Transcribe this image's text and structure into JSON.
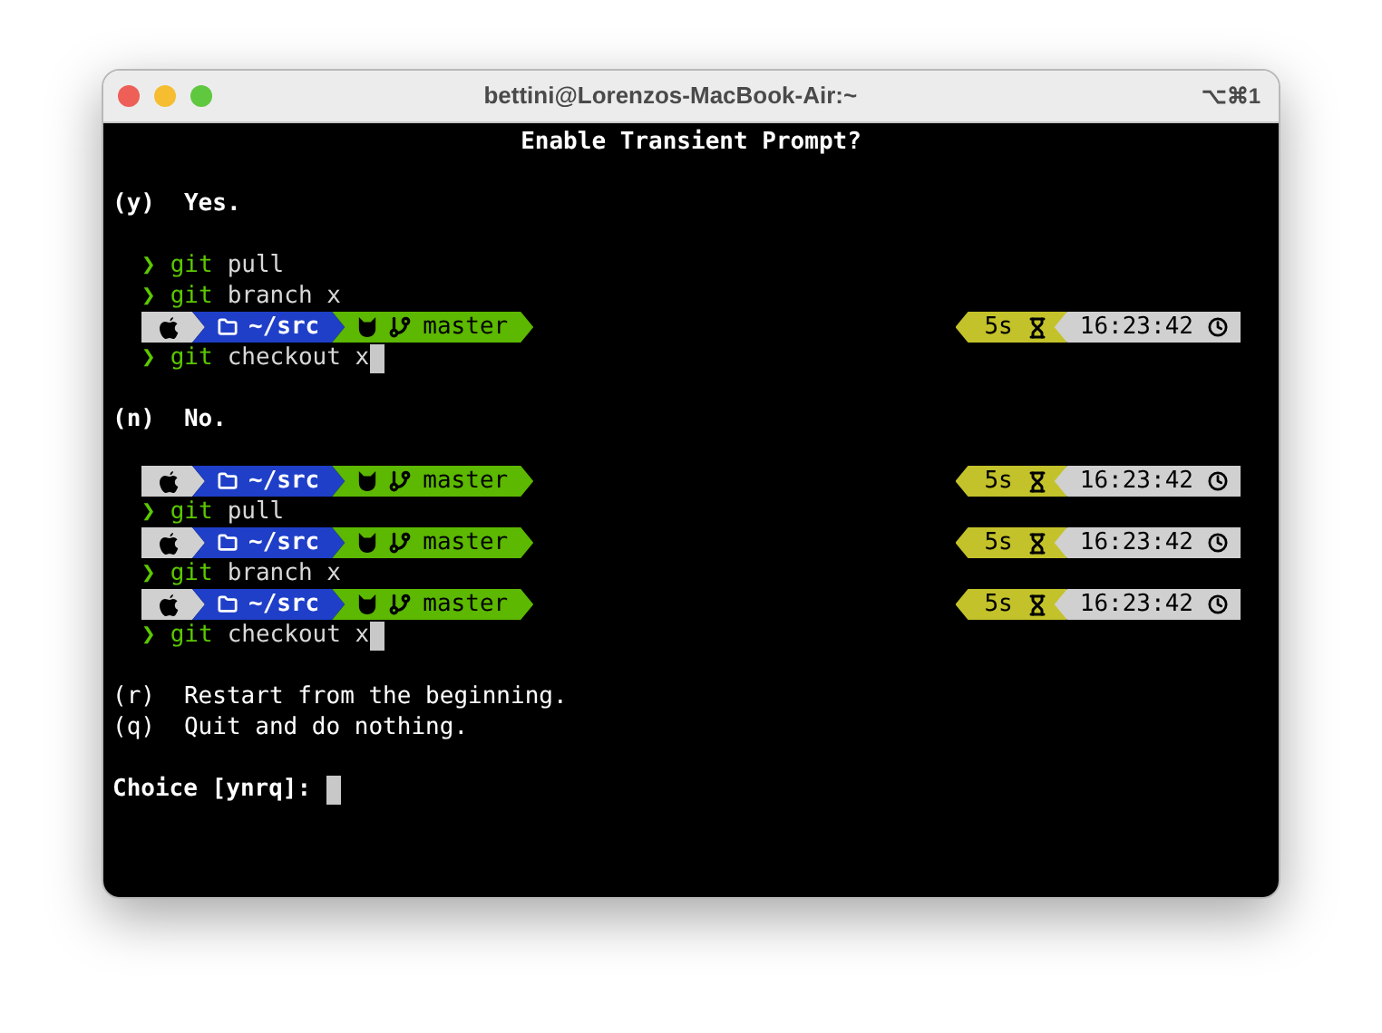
{
  "window": {
    "title": "bettini@Lorenzos-MacBook-Air:~",
    "shortcut": "⌥⌘1"
  },
  "lines": [
    {
      "kind": "heading",
      "text": "Enable Transient Prompt?"
    },
    {
      "kind": "blank"
    },
    {
      "kind": "option",
      "key": "(y)",
      "label": "Yes.",
      "bold": true
    },
    {
      "kind": "blank"
    },
    {
      "kind": "command",
      "prompt": "❯",
      "program": "git",
      "args": "pull",
      "cursor": false
    },
    {
      "kind": "command",
      "prompt": "❯",
      "program": "git",
      "args": "branch x",
      "cursor": false
    },
    {
      "kind": "prompt",
      "segments": [
        {
          "kind": "os",
          "color": "#d0d0d0"
        },
        {
          "kind": "dir",
          "text": "~/src",
          "color": "#1f3fc8"
        },
        {
          "kind": "git",
          "text": "master",
          "color": "#5cb800"
        }
      ],
      "right": [
        {
          "kind": "duration",
          "text": "5s",
          "color": "#c3c22a"
        },
        {
          "kind": "time",
          "text": "16:23:42",
          "color": "#d0d0d0"
        }
      ]
    },
    {
      "kind": "command",
      "prompt": "❯",
      "program": "git",
      "args": "checkout x",
      "cursor": true
    },
    {
      "kind": "blank"
    },
    {
      "kind": "option",
      "key": "(n)",
      "label": "No.",
      "bold": true
    },
    {
      "kind": "blank"
    },
    {
      "kind": "prompt",
      "segments": [
        {
          "kind": "os",
          "color": "#d0d0d0"
        },
        {
          "kind": "dir",
          "text": "~/src",
          "color": "#1f3fc8"
        },
        {
          "kind": "git",
          "text": "master",
          "color": "#5cb800"
        }
      ],
      "right": [
        {
          "kind": "duration",
          "text": "5s",
          "color": "#c3c22a"
        },
        {
          "kind": "time",
          "text": "16:23:42",
          "color": "#d0d0d0"
        }
      ]
    },
    {
      "kind": "command",
      "prompt": "❯",
      "program": "git",
      "args": "pull",
      "cursor": false
    },
    {
      "kind": "prompt",
      "segments": [
        {
          "kind": "os",
          "color": "#d0d0d0"
        },
        {
          "kind": "dir",
          "text": "~/src",
          "color": "#1f3fc8"
        },
        {
          "kind": "git",
          "text": "master",
          "color": "#5cb800"
        }
      ],
      "right": [
        {
          "kind": "duration",
          "text": "5s",
          "color": "#c3c22a"
        },
        {
          "kind": "time",
          "text": "16:23:42",
          "color": "#d0d0d0"
        }
      ]
    },
    {
      "kind": "command",
      "prompt": "❯",
      "program": "git",
      "args": "branch x",
      "cursor": false
    },
    {
      "kind": "prompt",
      "segments": [
        {
          "kind": "os",
          "color": "#d0d0d0"
        },
        {
          "kind": "dir",
          "text": "~/src",
          "color": "#1f3fc8"
        },
        {
          "kind": "git",
          "text": "master",
          "color": "#5cb800"
        }
      ],
      "right": [
        {
          "kind": "duration",
          "text": "5s",
          "color": "#c3c22a"
        },
        {
          "kind": "time",
          "text": "16:23:42",
          "color": "#d0d0d0"
        }
      ]
    },
    {
      "kind": "command",
      "prompt": "❯",
      "program": "git",
      "args": "checkout x",
      "cursor": true
    },
    {
      "kind": "blank"
    },
    {
      "kind": "option",
      "key": "(r)",
      "label": "Restart from the beginning.",
      "bold": false
    },
    {
      "kind": "option",
      "key": "(q)",
      "label": "Quit and do nothing.",
      "bold": false
    },
    {
      "kind": "blank"
    },
    {
      "kind": "input",
      "label": "Choice [ynrq]:",
      "cursor": true
    }
  ]
}
